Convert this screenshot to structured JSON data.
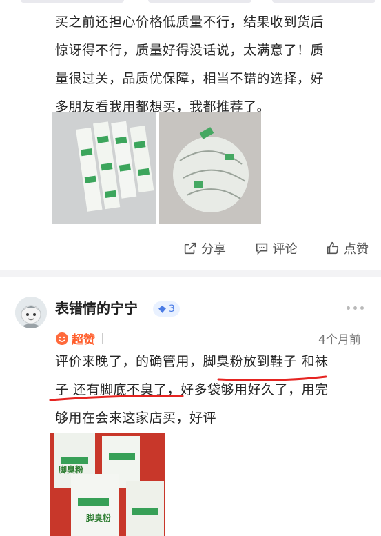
{
  "review1": {
    "text_lines": [
      "买之前还担心价格低质量不行，结果收到货后",
      "惊讶得不行，质量好得没话说，太满意了！质",
      "量很过关，品质优保障，相当不错的选择，好",
      "多朋友看我用都想买，我都推荐了。"
    ],
    "actions": {
      "share": "分享",
      "comment": "评论",
      "like": "点赞"
    }
  },
  "review2": {
    "username": "表错情的宁宁",
    "level": "3",
    "rating_label": "超赞",
    "time": "4个月前",
    "text_lines": [
      "评价来晚了，的确管用，脚臭粉放到鞋子 和袜",
      "子 还有脚底不臭了，好多袋够用好久了，用完",
      "够用在会来这家店买，好评"
    ],
    "product_label": "脚臭粉"
  },
  "colors": {
    "accent": "#ff5e2c",
    "highlight_red": "#e52421",
    "level_blue": "#4a7be5",
    "divider": "#f3f3f5"
  },
  "icons": [
    "share-icon",
    "comment-icon",
    "like-icon",
    "more-icon",
    "diamond-icon",
    "smile-icon"
  ]
}
